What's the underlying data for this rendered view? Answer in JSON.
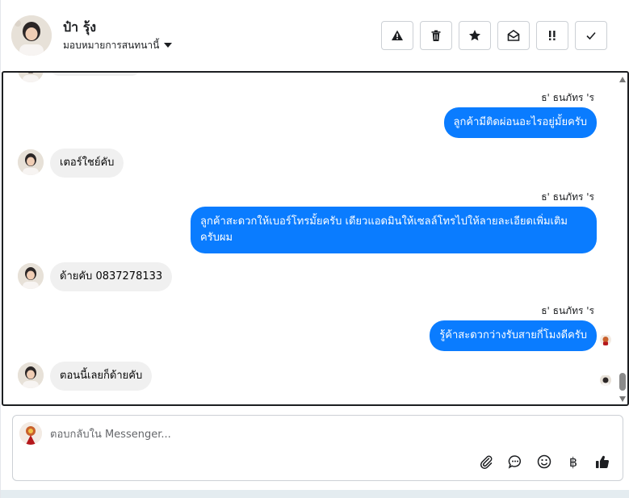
{
  "header": {
    "contact_name": "ป๋า รุ้ง",
    "assign_label": "มอบหมายการสนทนานี้",
    "actions": [
      {
        "icon": "warning-icon"
      },
      {
        "icon": "trash-icon"
      },
      {
        "icon": "star-icon"
      },
      {
        "icon": "envelope-open-icon"
      },
      {
        "icon": "follow-up-icon"
      },
      {
        "icon": "check-icon"
      }
    ]
  },
  "thread": {
    "messages": [
      {
        "direction": "outgoing",
        "sender": "ธ' ธนภัทร 'ร",
        "text": "ลูกค้ามีติดผ่อนอะไรอยู่มั้ยครับ"
      },
      {
        "direction": "incoming",
        "text": "เตอร์ใชย์คับ"
      },
      {
        "direction": "outgoing",
        "sender": "ธ' ธนภัทร 'ร",
        "text_line1": "ลูกค้าสะดวกให้เบอร์โทรมั้ยครับ เดียวแอดมินให้เซลล์โทรไปให้ลายละเอียดเพิ่มเติม",
        "text_line2": "ครับผม"
      },
      {
        "direction": "incoming",
        "text": "ด้ายคับ  0837278133"
      },
      {
        "direction": "outgoing",
        "sender": "ธ' ธนภัทร 'ร",
        "text": "รู้ค้าสะดวกว่างรับสายกี่โมงดีครับ"
      },
      {
        "direction": "incoming",
        "text": "ตอนนี้เลยก็ด้ายคับ"
      }
    ]
  },
  "composer": {
    "placeholder": "ตอบกลับใน Messenger...",
    "value": "",
    "tools": [
      "paperclip-icon",
      "chat-bubble-icon",
      "emoji-icon",
      "baht-icon",
      "thumbs-up-icon"
    ],
    "baht_glyph": "฿"
  },
  "colors": {
    "outgoing_bubble": "#0a7cff",
    "incoming_bubble": "#f0f0f0",
    "border": "#ccd0d5"
  }
}
